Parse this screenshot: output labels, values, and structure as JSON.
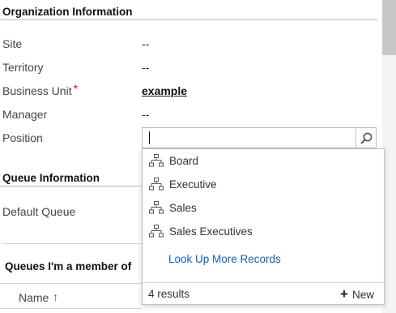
{
  "org_section": {
    "title": "Organization Information",
    "fields": [
      {
        "label": "Site",
        "value": "--"
      },
      {
        "label": "Territory",
        "value": "--"
      },
      {
        "label": "Business Unit",
        "value": "example",
        "required_mark": "*"
      },
      {
        "label": "Manager",
        "value": "--"
      },
      {
        "label": "Position",
        "value": ""
      }
    ]
  },
  "queue_section": {
    "title": "Queue Information",
    "default_queue_label": "Default Queue"
  },
  "member_section": {
    "title": "Queues I'm a member of",
    "column_name": "Name",
    "sort_icon": "↑"
  },
  "lookup": {
    "results": [
      {
        "icon": "hierarchy-icon",
        "label": "Board"
      },
      {
        "icon": "hierarchy-icon",
        "label": "Executive"
      },
      {
        "icon": "hierarchy-icon",
        "label": "Sales"
      },
      {
        "icon": "hierarchy-icon",
        "label": "Sales Executives"
      }
    ],
    "look_up_more": "Look Up More Records",
    "count": "4 results",
    "new_label": "New",
    "new_icon": "+"
  },
  "colors": {
    "link": "#1160b7",
    "required": "#e00000"
  }
}
